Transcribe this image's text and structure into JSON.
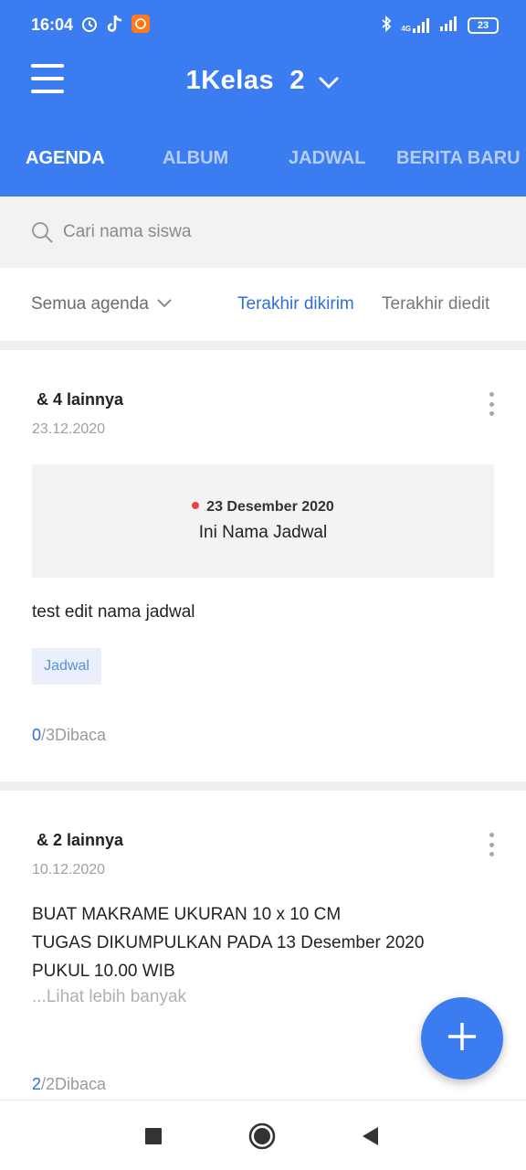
{
  "status_bar": {
    "time": "16:04",
    "network": "4G",
    "battery": "23"
  },
  "header": {
    "title": "1Kelas  2",
    "menu_icon": "hamburger-icon",
    "dropdown_icon": "chevron-down-icon"
  },
  "tabs": [
    {
      "label": "AGENDA",
      "active": true
    },
    {
      "label": "ALBUM",
      "active": false
    },
    {
      "label": "JADWAL",
      "active": false
    },
    {
      "label": "BERITA BARU",
      "active": false
    }
  ],
  "search": {
    "placeholder": "Cari nama siswa"
  },
  "filters": {
    "category": "Semua agenda",
    "sort_options": [
      "Terakhir dikirim",
      "Terakhir diedit"
    ],
    "active_sort": "Terakhir dikirim"
  },
  "posts": [
    {
      "recipients": "& 4 lainnya",
      "date": "23.12.2020",
      "schedule": {
        "date": "23 Desember 2020",
        "name": "Ini Nama Jadwal"
      },
      "text": "test edit nama jadwal",
      "tag": "Jadwal",
      "read_count": "0",
      "read_total": "/3Dibaca"
    },
    {
      "recipients": "& 2 lainnya",
      "date": "10.12.2020",
      "text": "BUAT MAKRAME UKURAN 10 x 10 CM\nTUGAS DIKUMPULKAN PADA 13 Desember 2020\nPUKUL 10.00 WIB",
      "more": "...Lihat lebih banyak",
      "read_count": "2",
      "read_total": "/2Dibaca"
    }
  ],
  "colors": {
    "primary": "#3b7cf0",
    "link": "#2f6fd6",
    "dot_red": "#e84545"
  }
}
